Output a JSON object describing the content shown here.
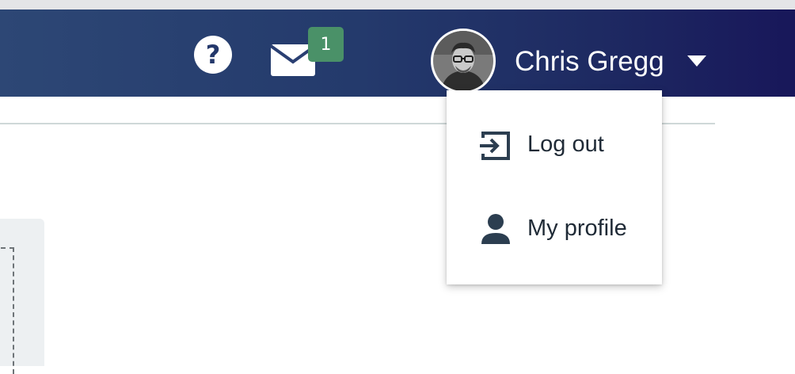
{
  "header": {
    "background_colors": [
      "#2d4775",
      "#18175a"
    ],
    "help_icon": "help-circle-icon",
    "mail": {
      "icon": "envelope-icon",
      "badge_count": "1",
      "badge_color": "#4a9168"
    },
    "user": {
      "name": "Chris Gregg",
      "avatar_icon": "user-avatar-photo",
      "caret_icon": "caret-down-icon"
    }
  },
  "user_menu": {
    "items": [
      {
        "label": "Log out",
        "icon": "log-out-icon"
      },
      {
        "label": "My profile",
        "icon": "person-icon"
      }
    ],
    "text_color": "#1f2a36"
  }
}
